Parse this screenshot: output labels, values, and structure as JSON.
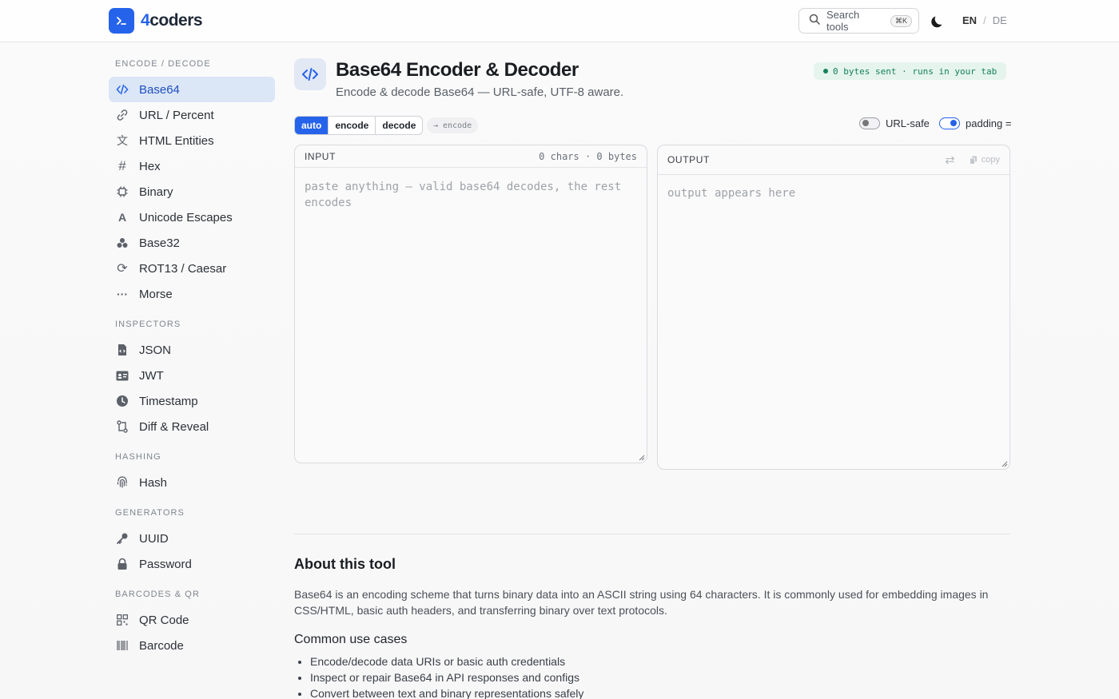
{
  "brand": {
    "prefix": "4",
    "name": "coders",
    "accent": "#2563eb"
  },
  "header": {
    "search_label": "Search tools",
    "search_shortcut": "⌘K",
    "lang_en": "EN",
    "lang_sep": "/",
    "lang_de": "DE"
  },
  "sidebar": {
    "groups": [
      {
        "title": "ENCODE / DECODE",
        "items": [
          "Base64",
          "URL / Percent",
          "HTML Entities",
          "Hex",
          "Binary",
          "Unicode Escapes",
          "Base32",
          "ROT13 / Caesar",
          "Morse"
        ]
      },
      {
        "title": "INSPECTORS",
        "items": [
          "JSON",
          "JWT",
          "Timestamp",
          "Diff & Reveal"
        ]
      },
      {
        "title": "HASHING",
        "items": [
          "Hash"
        ]
      },
      {
        "title": "GENERATORS",
        "items": [
          "UUID",
          "Password"
        ]
      },
      {
        "title": "BARCODES & QR",
        "items": [
          "QR Code",
          "Barcode"
        ]
      }
    ],
    "active_item": "Base64"
  },
  "tool": {
    "title": "Base64 Encoder & Decoder",
    "subtitle": "Encode & decode Base64 — URL-safe, UTF-8 aware.",
    "privacy_badge": "0 bytes sent · runs in your tab",
    "modes": [
      "auto",
      "encode",
      "decode"
    ],
    "active_mode": "auto",
    "mode_hint": "→ encode",
    "toggle_urlsafe": "URL-safe",
    "toggle_padding": "padding =",
    "urlsafe_on": false,
    "padding_on": true
  },
  "input": {
    "label": "INPUT",
    "meta": "0 chars · 0 bytes",
    "placeholder": "paste anything — valid base64 decodes, the rest encodes"
  },
  "output": {
    "label": "OUTPUT",
    "copy_label": "copy",
    "placeholder": "output appears here"
  },
  "about": {
    "title": "About this tool",
    "text": "Base64 is an encoding scheme that turns binary data into an ASCII string using 64 characters. It is commonly used for embedding images in CSS/HTML, basic auth headers, and transferring binary over text protocols.",
    "usecases_title": "Common use cases",
    "usecases": [
      "Encode/decode data URIs or basic auth credentials",
      "Inspect or repair Base64 in API responses and configs",
      "Convert between text and binary representations safely"
    ]
  }
}
